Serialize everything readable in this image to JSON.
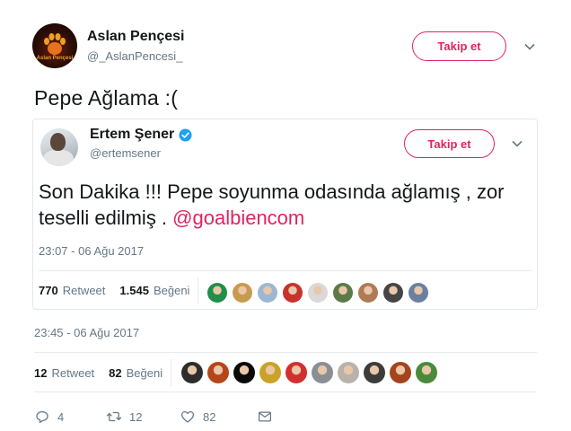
{
  "author": {
    "name": "Aslan Pençesi",
    "handle": "@_AslanPencesi_",
    "avatar_icon": "lion-paw-logo",
    "avatar_logo_text": "Aslan Pençesi"
  },
  "follow_label": "Takip et",
  "tweet": {
    "text": "Pepe Ağlama :(",
    "timestamp": "23:45 - 06 Ağu 2017",
    "retweet_count": "12",
    "retweet_label": "Retweet",
    "like_count": "82",
    "like_label": "Beğeni",
    "liker_faces": [
      "#2d2d2d",
      "#b5461a",
      "#0a0a0a",
      "#c9a227",
      "#d1302e",
      "#8a8f94",
      "#b8b2aa",
      "#3c3c3c",
      "#a4441c",
      "#4a8a3a"
    ]
  },
  "quoted": {
    "name": "Ertem Şener",
    "handle": "@ertemsener",
    "verified_icon": "verified-badge-icon",
    "follow_label": "Takip et",
    "text_main": "Son Dakika !!! Pepe soyunma odasında ağlamış , zor teselli edilmiş . ",
    "text_link": "@goalbiencom",
    "timestamp": "23:07 - 06 Ağu 2017",
    "retweet_count": "770",
    "retweet_label": "Retweet",
    "like_count": "1.545",
    "like_label": "Beğeni",
    "liker_faces": [
      "#1f8f4a",
      "#c89a4e",
      "#9bb8d3",
      "#c6332d",
      "#d9d9d9",
      "#5d7a4a",
      "#b07a56",
      "#454545",
      "#6b7fa0"
    ]
  },
  "actions": {
    "reply_count": "4",
    "retweet_count": "12",
    "like_count": "82"
  },
  "colors": {
    "accent": "#e0245e",
    "secondary_text": "#657786",
    "verified_blue": "#1da1f2"
  }
}
